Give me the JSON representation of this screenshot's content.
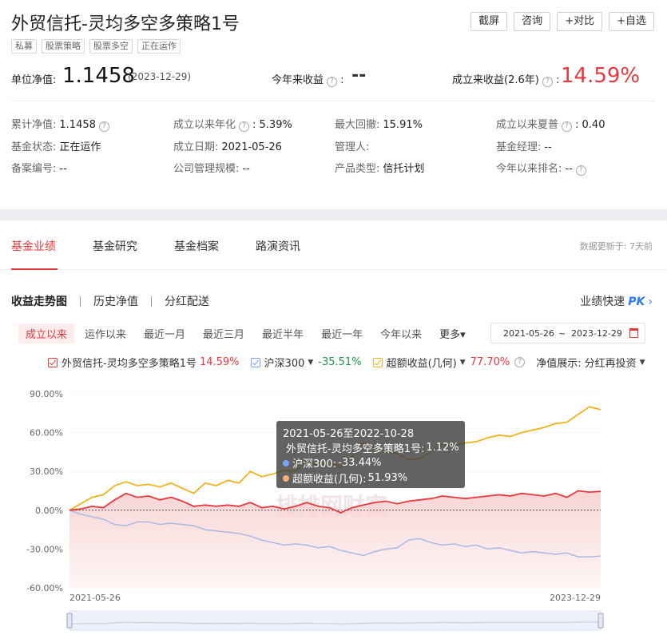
{
  "header": {
    "title": "外贸信托-灵均多空多策略1号",
    "tags": [
      "私募",
      "股票策略",
      "股票多空",
      "正在运作"
    ],
    "buttons": [
      "截屏",
      "咨询",
      "+对比",
      "+自选"
    ]
  },
  "nav": {
    "label": "单位净值:",
    "value": "1.1458",
    "date": "(2023-12-29)",
    "ytd_label": "今年来收益",
    "ytd_value": "--",
    "since_label": "成立来收益(2.6年)",
    "since_value": "14.59%"
  },
  "info": [
    {
      "k": "累计净值:",
      "v": "1.1458",
      "q": true
    },
    {
      "k": "成立以来年化",
      "v": ": 5.39%",
      "q": true
    },
    {
      "k": "最大回撤:",
      "v": "15.91%",
      "q": false
    },
    {
      "k": "成立以来夏普",
      "v": ": 0.40",
      "q": true
    },
    {
      "k": "基金状态:",
      "v": "正在运作",
      "q": false
    },
    {
      "k": "成立日期:",
      "v": "2021-05-26",
      "q": false
    },
    {
      "k": "管理人:",
      "v": "",
      "q": false
    },
    {
      "k": "基金经理:",
      "v": "--",
      "q": false
    },
    {
      "k": "备案编号:",
      "v": "--",
      "q": false
    },
    {
      "k": "公司管理规模:",
      "v": "--",
      "q": false
    },
    {
      "k": "产品类型:",
      "v": "信托计划",
      "q": false
    },
    {
      "k": "今年以来排名:",
      "v": "--",
      "q": true
    }
  ],
  "tabs": [
    "基金业绩",
    "基金研究",
    "基金档案",
    "路演资讯"
  ],
  "update_text": "数据更新于: 7天前",
  "subtabs": [
    "收益走势图",
    "历史净值",
    "分红配送"
  ],
  "pk": {
    "label": "业绩快速",
    "pk": "PK",
    "arrow": "›"
  },
  "ranges": [
    "成立以来",
    "运作以来",
    "最近一月",
    "最近三月",
    "最近半年",
    "最近一年",
    "今年以来",
    "更多▾"
  ],
  "date_range": {
    "start": "2021-05-26",
    "tilde": "~",
    "end": "2023-12-29"
  },
  "legend": {
    "fund": {
      "name": "外贸信托-灵均多空多策略1号",
      "value": "14.59%"
    },
    "index": {
      "name": "沪深300",
      "value": "-35.51%"
    },
    "excess": {
      "name": "超额收益(几何)",
      "value": "77.70%"
    },
    "mode_label": "净值展示:",
    "mode_value": "分红再投资"
  },
  "colors": {
    "fund": "#e8383c",
    "index": "#a9b9e2",
    "excess": "#f0b21e",
    "accent": "#e8383c",
    "index_value": "#1a9a4a"
  },
  "tooltip": {
    "title": "2021-05-26至2022-10-28",
    "rows": [
      {
        "label": "外贸信托-灵均多空多策略1号:",
        "value": "1.12%",
        "color": "#e8383c"
      },
      {
        "label": "沪深300:",
        "value": "-33.44%",
        "color": "#7aa4f0"
      },
      {
        "label": "超额收益(几何):",
        "value": "51.93%",
        "color": "#f5b07a"
      }
    ]
  },
  "chart_data": {
    "type": "line",
    "x_start": "2021-05-26",
    "x_end": "2023-12-29",
    "x_tick_labels": [
      "2021-05-26",
      "2023-12-29"
    ],
    "y_tick_labels": [
      "90.00%",
      "60.00%",
      "30.00%",
      "0.00%",
      "-30.00%",
      "-60.00%"
    ],
    "ylim": [
      -60,
      90
    ],
    "ylabel_unit": "%",
    "watermark": "排排网财富",
    "series": [
      {
        "name": "外贸信托-灵均多空多策略1号",
        "values": [
          0,
          1,
          3,
          2,
          8,
          13,
          10,
          11,
          8,
          10,
          7,
          3,
          4,
          3,
          4,
          3,
          6,
          2,
          3,
          1,
          3,
          6,
          3,
          2,
          -2,
          2,
          4,
          6,
          7,
          5,
          7,
          8,
          9,
          11,
          10,
          9,
          10,
          11,
          12,
          11,
          13,
          12,
          11,
          13,
          10,
          15,
          14,
          14.59
        ]
      },
      {
        "name": "沪深300",
        "values": [
          0,
          -3,
          -5,
          -7,
          -11,
          -12,
          -9,
          -9,
          -11,
          -10,
          -11,
          -12,
          -15,
          -16,
          -17,
          -18,
          -20,
          -23,
          -25,
          -27,
          -26,
          -27,
          -29,
          -28,
          -31,
          -33,
          -35,
          -32,
          -30,
          -29,
          -23,
          -22,
          -25,
          -27,
          -26,
          -28,
          -27,
          -30,
          -29,
          -31,
          -33,
          -32,
          -33,
          -34,
          -33,
          -36,
          -36,
          -35.51
        ]
      },
      {
        "name": "超额收益(几何)",
        "values": [
          0,
          5,
          10,
          12,
          19,
          22,
          19,
          20,
          18,
          21,
          17,
          13,
          21,
          19,
          23,
          21,
          30,
          26,
          28,
          31,
          30,
          37,
          35,
          37,
          33,
          42,
          52,
          48,
          45,
          44,
          39,
          40,
          45,
          51,
          50,
          52,
          53,
          56,
          58,
          57,
          60,
          62,
          64,
          67,
          68,
          74,
          80,
          77.7
        ]
      }
    ]
  }
}
